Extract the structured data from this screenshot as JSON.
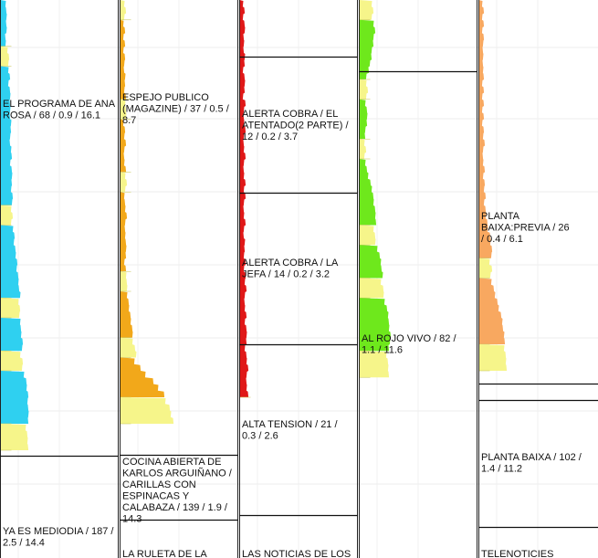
{
  "chart_data": {
    "type": "area",
    "grid": true,
    "series": [
      {
        "name": "",
        "color": "#2fd0f0",
        "alt_color": "#f6f58a",
        "segments": [
          {
            "alt": false,
            "width": [
              6,
              6,
              7,
              6,
              7,
              5,
              6
            ]
          },
          {
            "alt": true,
            "width": [
              8,
              9,
              9
            ]
          },
          {
            "alt": false,
            "width": [
              9,
              10,
              9,
              10,
              11,
              10,
              11,
              10,
              12,
              11,
              11,
              10,
              12,
              12,
              11,
              12,
              13,
              12,
              12,
              13,
              13
            ]
          },
          {
            "alt": true,
            "width": [
              12,
              13,
              12
            ]
          },
          {
            "alt": false,
            "width": [
              14,
              15,
              15,
              16,
              17,
              18,
              18,
              19,
              20,
              20,
              22
            ]
          },
          {
            "alt": true,
            "width": [
              20,
              21,
              21
            ]
          },
          {
            "alt": false,
            "width": [
              22,
              22,
              23,
              24,
              24
            ]
          },
          {
            "alt": true,
            "width": [
              22,
              24,
              24
            ]
          },
          {
            "alt": false,
            "width": [
              26,
              28,
              29,
              30,
              30,
              30,
              31,
              30
            ]
          },
          {
            "alt": true,
            "width": [
              28,
              29,
              30,
              30
            ]
          }
        ],
        "programs": [
          {
            "label": "EL PROGRAMA DE ANA ROSA / 68 / 0.9 / 16.1",
            "rule": false
          },
          {
            "label": "YA ES MEDIODIA / 187 / 2.5 / 14.4",
            "rule": true
          }
        ]
      },
      {
        "name": "",
        "color": "#f2a81a",
        "alt_color": "#f6f58a",
        "segments": [
          {
            "alt": true,
            "width": [
              5,
              6,
              5
            ]
          },
          {
            "alt": false,
            "width": [
              4,
              5,
              4,
              5,
              4,
              5,
              5,
              4,
              6,
              5,
              5,
              6
            ]
          },
          {
            "alt": true,
            "width": [
              6,
              6,
              7
            ]
          },
          {
            "alt": false,
            "width": [
              4,
              5,
              5,
              6,
              5,
              4,
              5,
              6
            ]
          },
          {
            "alt": true,
            "width": [
              6,
              7,
              6
            ]
          },
          {
            "alt": false,
            "width": [
              5,
              5,
              6,
              7,
              6,
              5,
              6,
              6,
              7,
              6,
              5,
              6
            ]
          },
          {
            "alt": true,
            "width": [
              7,
              7,
              8
            ]
          },
          {
            "alt": false,
            "width": [
              8,
              9,
              10,
              11,
              12,
              13,
              14
            ]
          },
          {
            "alt": true,
            "width": [
              14,
              16,
              18
            ]
          },
          {
            "alt": false,
            "width": [
              16,
              22,
              28,
              36,
              42,
              48
            ]
          },
          {
            "alt": true,
            "width": [
              50,
              54,
              56,
              58
            ]
          }
        ],
        "programs": [
          {
            "label": "ESPEJO PUBLICO (MAGAZINE) / 37 / 0.5 / 8.7",
            "rule": false
          },
          {
            "label": "COCINA ABIERTA DE KARLOS ARGUIÑANO / CARILLAS CON ESPINACAS Y CALABAZA / 139 / 1.9 / 14.3",
            "rule": true
          },
          {
            "label": "LA RULETA DE LA",
            "rule": true
          }
        ]
      },
      {
        "name": "",
        "color": "#e01818",
        "alt_color": "#f6f58a",
        "segments": [
          {
            "alt": false,
            "width": [
              4,
              5,
              4,
              5,
              6,
              4,
              5,
              4,
              6,
              5,
              4,
              5,
              6,
              5,
              4,
              6,
              5,
              4,
              5,
              6,
              5,
              4,
              5,
              6,
              5,
              4,
              5,
              6,
              5,
              6,
              5,
              4,
              5,
              6,
              5,
              4,
              6,
              5,
              5,
              6,
              5,
              6,
              6,
              7,
              6,
              5,
              6,
              7,
              6,
              7,
              8,
              7,
              6,
              7,
              8,
              9,
              8,
              7,
              8,
              9
            ]
          }
        ],
        "programs": [
          {
            "label": "",
            "rule": true
          },
          {
            "label": "ALERTA COBRA / EL ATENTADO(2 PARTE) / 12 / 0.2 / 3.7",
            "rule": true
          },
          {
            "label": "ALERTA COBRA / LA JEFA / 14 / 0.2 / 3.2",
            "rule": true
          },
          {
            "label": "ALTA TENSION / 21 / 0.3 / 2.6",
            "rule": true
          },
          {
            "label": "LAS NOTICIAS DE LOS",
            "rule": true
          }
        ]
      },
      {
        "name": "",
        "color": "#6ee81c",
        "alt_color": "#f6f58a",
        "segments": [
          {
            "alt": true,
            "width": [
              14,
              15,
              14
            ]
          },
          {
            "alt": false,
            "width": [
              16,
              17,
              16,
              15,
              14,
              13,
              12,
              10,
              8
            ]
          },
          {
            "alt": true,
            "width": [
              8,
              9,
              8
            ]
          },
          {
            "alt": false,
            "width": [
              7,
              8,
              9,
              8,
              7,
              6
            ]
          },
          {
            "alt": true,
            "width": [
              6,
              7,
              6
            ]
          },
          {
            "alt": false,
            "width": [
              7,
              8,
              10,
              12,
              14,
              15,
              16,
              17,
              18,
              18
            ]
          },
          {
            "alt": true,
            "width": [
              16,
              17,
              18
            ]
          },
          {
            "alt": false,
            "width": [
              20,
              22,
              24,
              24,
              26
            ]
          },
          {
            "alt": true,
            "width": [
              24,
              26,
              27
            ]
          },
          {
            "alt": false,
            "width": [
              28,
              30,
              32,
              32,
              33,
              34,
              34,
              32
            ]
          },
          {
            "alt": true,
            "width": [
              30,
              31,
              32,
              32
            ]
          }
        ],
        "programs": [
          {
            "label": "",
            "rule": true
          },
          {
            "label": "AL ROJO VIVO / 82 / 1.1 / 11.6",
            "rule": false
          }
        ]
      },
      {
        "name": "",
        "color": "#f8a860",
        "alt_color": "#f6f58a",
        "segments": [
          {
            "alt": false,
            "width": [
              4,
              5,
              4,
              5,
              4,
              5,
              5,
              4,
              5,
              4,
              5,
              5,
              4,
              5,
              4,
              5,
              4,
              5,
              4,
              5,
              5,
              6,
              5,
              4,
              5,
              6,
              5,
              6,
              6,
              7,
              6,
              7,
              8,
              9,
              10,
              12,
              13,
              14,
              14
            ]
          },
          {
            "alt": true,
            "width": [
              12,
              14,
              13
            ]
          },
          {
            "alt": false,
            "width": [
              14,
              16,
              18,
              20,
              22,
              24,
              26,
              26,
              28,
              28
            ]
          },
          {
            "alt": true,
            "width": [
              28,
              29,
              30,
              30
            ]
          }
        ],
        "programs": [
          {
            "label": "PLANTA BAIXA:PREVIA / 26 / 0.4 / 6.1",
            "rule": false
          },
          {
            "label": "PLANTA BAIXA / 102 / 1.4 / 11.2",
            "rule": true
          },
          {
            "label": "TELENOTICIES",
            "rule": true
          }
        ]
      }
    ]
  }
}
